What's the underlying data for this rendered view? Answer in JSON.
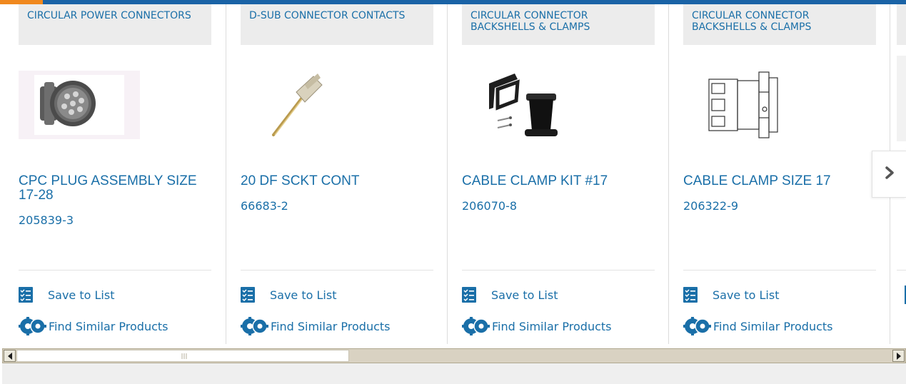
{
  "products": [
    {
      "category": "CIRCULAR POWER CONNECTORS",
      "title": "CPC PLUG ASSEMBLY SIZE 17-28",
      "part_number": "205839-3",
      "save_label": "Save to List",
      "similar_label": "Find Similar Products",
      "image": "circular-connector-plug"
    },
    {
      "category": "D-SUB CONNECTOR CONTACTS",
      "title": "20 DF SCKT CONT",
      "part_number": "66683-2",
      "save_label": "Save to List",
      "similar_label": "Find Similar Products",
      "image": "dsub-socket-contact"
    },
    {
      "category": "CIRCULAR CONNECTOR BACKSHELLS & CLAMPS",
      "title": "CABLE CLAMP KIT #17",
      "part_number": "206070-8",
      "save_label": "Save to List",
      "similar_label": "Find Similar Products",
      "image": "cable-clamp-kit"
    },
    {
      "category": "CIRCULAR CONNECTOR BACKSHELLS & CLAMPS",
      "title": "CABLE CLAMP SIZE 17",
      "part_number": "206322-9",
      "save_label": "Save to List",
      "similar_label": "Find Similar Products",
      "image": "cable-clamp-drawing"
    }
  ],
  "carousel": {
    "next_icon": "chevron-right-icon"
  },
  "colors": {
    "link": "#1a6fa8",
    "accent": "#f0881e",
    "brand": "#1a63a6",
    "category_bg": "#ececec"
  }
}
